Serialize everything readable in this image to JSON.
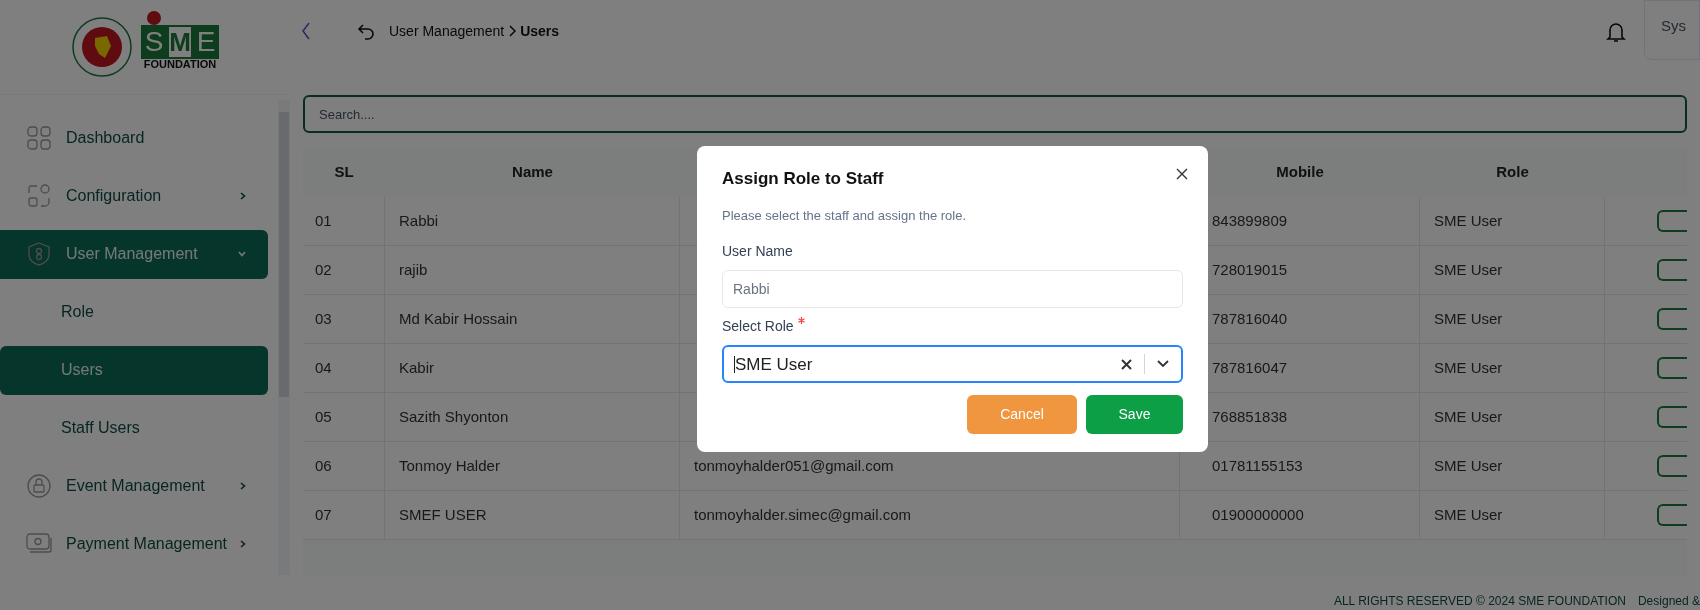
{
  "logo": {
    "text": "FOUNDATION",
    "letters": [
      "S",
      "M",
      "E"
    ]
  },
  "sidebar": {
    "items": [
      {
        "label": "Dashboard",
        "kind": "link",
        "selected": false
      },
      {
        "label": "Configuration",
        "kind": "group",
        "expanded": false,
        "selected": false
      },
      {
        "label": "User Management",
        "kind": "group",
        "expanded": true,
        "selected": true,
        "children": [
          {
            "label": "Role",
            "selected": false
          },
          {
            "label": "Users",
            "selected": true
          },
          {
            "label": "Staff Users",
            "selected": false
          }
        ]
      },
      {
        "label": "Event Management",
        "kind": "group",
        "expanded": false,
        "selected": false
      },
      {
        "label": "Payment Management",
        "kind": "group",
        "expanded": false,
        "selected": false
      }
    ]
  },
  "header": {
    "breadcrumb": [
      "User Management",
      "Users"
    ],
    "user_box": "Sys"
  },
  "search": {
    "placeholder": "Search...."
  },
  "table": {
    "columns": [
      "SL",
      "Name",
      "",
      "Mobile",
      "Role",
      ""
    ],
    "rows": [
      {
        "sl": "01",
        "name": "Rabbi",
        "mobile": "843899809",
        "role": "SME User"
      },
      {
        "sl": "02",
        "name": "rajib",
        "mobile": "728019015",
        "role": "SME User"
      },
      {
        "sl": "03",
        "name": "Md Kabir Hossain",
        "mobile": "787816040",
        "role": "SME User"
      },
      {
        "sl": "04",
        "name": "Kabir",
        "mobile": "787816047",
        "role": "SME User"
      },
      {
        "sl": "05",
        "name": "Sazith Shyonton",
        "mobile": "768851838",
        "role": "SME User"
      },
      {
        "sl": "06",
        "name": "Tonmoy Halder",
        "email": "tonmoyhalder051@gmail.com",
        "mobile": "01781155153",
        "role": "SME User"
      },
      {
        "sl": "07",
        "name": "SMEF USER",
        "email": "tonmoyhalder.simec@gmail.com",
        "mobile": "01900000000",
        "role": "SME User"
      }
    ]
  },
  "footer": {
    "copyright": "ALL RIGHTS RESERVED © 2024 SME FOUNDATION",
    "credit": "Designed &"
  },
  "modal": {
    "title": "Assign Role to Staff",
    "subtitle": "Please select the staff and assign the role.",
    "fields": [
      {
        "label": "User Name",
        "kind": "text",
        "value": "Rabbi",
        "disabled": true
      },
      {
        "label": "Select Role",
        "kind": "select",
        "value": "SME User",
        "required": true,
        "focused": true
      }
    ],
    "buttons": [
      {
        "label": "Cancel",
        "kind": "cancel"
      },
      {
        "label": "Save",
        "kind": "save"
      }
    ]
  }
}
